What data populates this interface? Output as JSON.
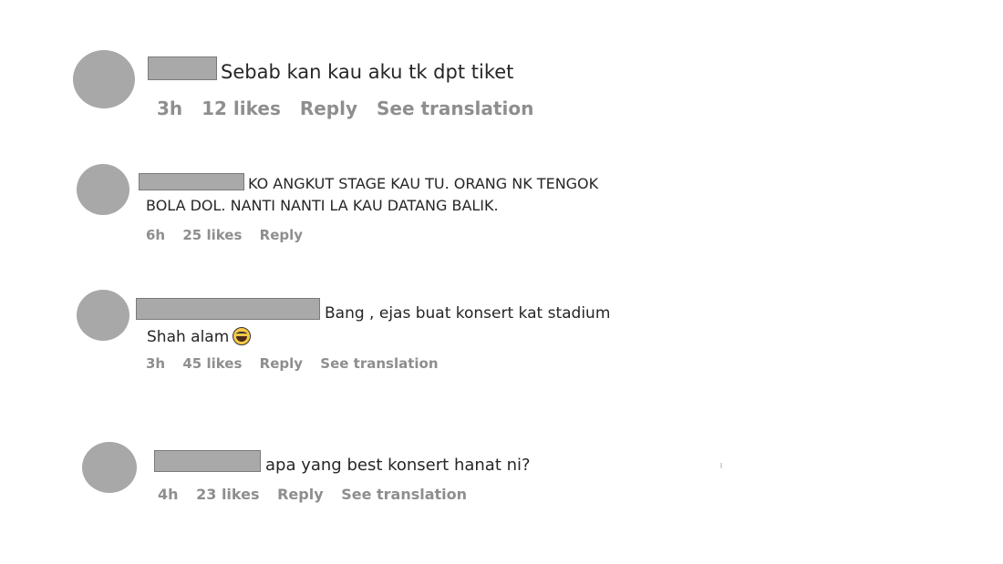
{
  "comments": [
    {
      "text": "Sebab kan kau aku tk dpt tiket",
      "time": "3h",
      "likes": "12 likes",
      "reply": "Reply",
      "translate": "See translation"
    },
    {
      "text_line1": "KO ANGKUT STAGE KAU TU. ORANG NK TENGOK",
      "text_line2": "BOLA DOL. NANTI NANTI LA KAU DATANG BALIK.",
      "time": "6h",
      "likes": "25 likes",
      "reply": "Reply"
    },
    {
      "text_line1": "Bang , ejas buat konsert kat stadium",
      "text_line2": "Shah alam",
      "emoji": "face-with-tears-of-joy",
      "time": "3h",
      "likes": "45 likes",
      "reply": "Reply",
      "translate": "See translation"
    },
    {
      "text": "apa yang best konsert hanat ni?",
      "time": "4h",
      "likes": "23 likes",
      "reply": "Reply",
      "translate": "See translation"
    }
  ]
}
